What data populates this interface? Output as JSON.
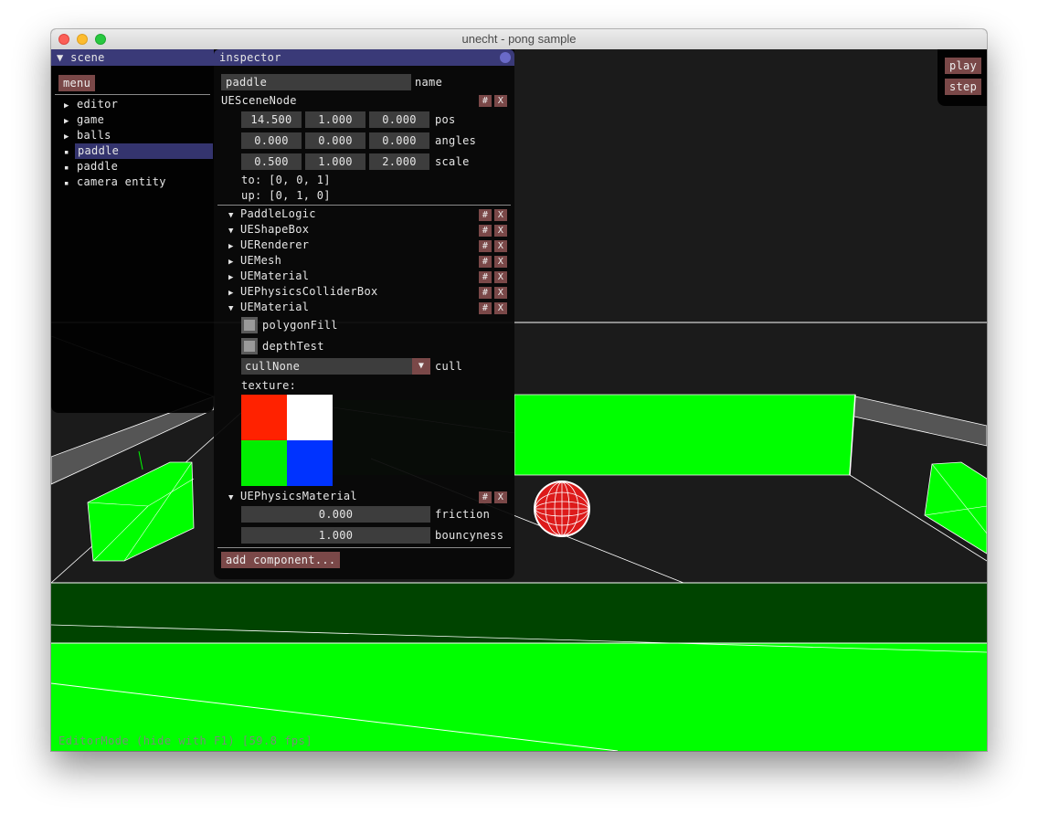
{
  "window": {
    "title": "unecht - pong sample"
  },
  "scene_panel": {
    "title": "scene",
    "menu_label": "menu",
    "items": [
      {
        "label": "editor",
        "expandable": true
      },
      {
        "label": "game",
        "expandable": true
      },
      {
        "label": "balls",
        "expandable": true
      },
      {
        "label": "paddle",
        "expandable": false,
        "selected": true
      },
      {
        "label": "paddle",
        "expandable": false
      },
      {
        "label": "camera entity",
        "expandable": false
      }
    ]
  },
  "inspector": {
    "title": "inspector",
    "name_value": "paddle",
    "name_label": "name",
    "scene_node": {
      "label": "UESceneNode",
      "pos": [
        "14.500",
        "1.000",
        "0.000"
      ],
      "pos_label": "pos",
      "angles": [
        "0.000",
        "0.000",
        "0.000"
      ],
      "angles_label": "angles",
      "scale": [
        "0.500",
        "1.000",
        "2.000"
      ],
      "scale_label": "scale",
      "to": "to: [0, 0, 1]",
      "up": "up: [0, 1, 0]"
    },
    "hash_label": "#",
    "close_label": "X",
    "components": [
      {
        "label": "PaddleLogic",
        "expanded": true
      },
      {
        "label": "UEShapeBox",
        "expanded": true
      },
      {
        "label": "UERenderer",
        "expanded": false
      },
      {
        "label": "UEMesh",
        "expanded": false
      },
      {
        "label": "UEMaterial",
        "expanded": false
      },
      {
        "label": "UEPhysicsColliderBox",
        "expanded": false
      },
      {
        "label": "UEMaterial",
        "expanded": true
      }
    ],
    "material": {
      "polygon_fill_label": "polygonFill",
      "depth_test_label": "depthTest",
      "cull_value": "cullNone",
      "cull_label": "cull",
      "texture_label": "texture:",
      "texture_colors": [
        "#ff2200",
        "#ffffff",
        "#00ee00",
        "#0033ff"
      ]
    },
    "physics_material": {
      "label": "UEPhysicsMaterial",
      "friction_value": "0.000",
      "friction_label": "friction",
      "bouncyness_value": "1.000",
      "bouncyness_label": "bouncyness"
    },
    "add_component_label": "add  component..."
  },
  "controls": {
    "play_label": "play",
    "step_label": "step"
  },
  "status": "EditorMode (hide with F1) [59.8 fps]",
  "colors": {
    "panel_title": "#3a3a78",
    "button": "#7a4848",
    "field": "#3d3d3d",
    "field_green": "#00ff00",
    "dark_green": "#004400"
  }
}
